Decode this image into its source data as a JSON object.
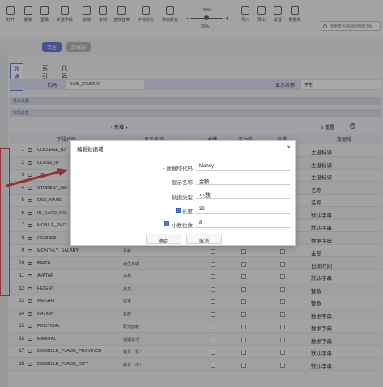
{
  "toolbar": {
    "buttons": [
      "打开",
      "撤销",
      "重做",
      "新建字段",
      "删除",
      "复制",
      "查找替换",
      "字体颜色",
      "填充颜色",
      "导入",
      "导出",
      "设置",
      "数据库"
    ],
    "zoom": "100%",
    "zoom_label": "50%",
    "search_placeholder": "搜索表名/视图/存储过程"
  },
  "doc_tabs": [
    "学生",
    "数据表"
  ],
  "sub_tabs": [
    "数据表",
    "索引",
    "代码"
  ],
  "code_row": {
    "code_label": "代码",
    "code_value": "SIMS_STUDENT",
    "display_label": "显示名称",
    "display_value": "学生"
  },
  "sections": [
    "基本设置",
    "字段信息"
  ],
  "table_toolbar": {
    "new_label": "+ 新增 ▾",
    "reset_label": "≡ 重置",
    "info": "?"
  },
  "columns": [
    "字段代码",
    "显示名称",
    "主键",
    "不为空",
    "自增",
    "数据域"
  ],
  "rows": [
    {
      "no": "1",
      "code": "COLLEGE_ID",
      "display": "",
      "domain": "主键标识"
    },
    {
      "no": "2",
      "code": "CLASS_ID",
      "display": "",
      "domain": "主键标识"
    },
    {
      "no": "3",
      "code": "_ID",
      "display": "",
      "domain": "主键标识"
    },
    {
      "no": "4",
      "code": "STUDENT_NA",
      "display": "",
      "domain": "名称"
    },
    {
      "no": "5",
      "code": "ENG_NAME",
      "display": "",
      "domain": "名称"
    },
    {
      "no": "6",
      "code": "ID_CARD_NO",
      "display": "",
      "domain": "默认字串"
    },
    {
      "no": "7",
      "code": "MOBILE_PHO",
      "display": "",
      "domain": "默认字串"
    },
    {
      "no": "8",
      "code": "GENDER",
      "display": "",
      "domain": "数据字典"
    },
    {
      "no": "9",
      "code": "MONTHLY_SALARY",
      "display": "月薪",
      "domain": "金额"
    },
    {
      "no": "10",
      "code": "BIRTH",
      "display": "出生日期",
      "domain": "日期时间"
    },
    {
      "no": "11",
      "code": "AVATAR",
      "display": "头像",
      "domain": "默认字串"
    },
    {
      "no": "12",
      "code": "HEIGHT",
      "display": "身高",
      "domain": "整数"
    },
    {
      "no": "13",
      "code": "WEIGHT",
      "display": "体重",
      "domain": "整数"
    },
    {
      "no": "14",
      "code": "NATION",
      "display": "名族",
      "domain": "数据字典"
    },
    {
      "no": "15",
      "code": "POLITICAL",
      "display": "政治面貌",
      "domain": "数据字典"
    },
    {
      "no": "16",
      "code": "MARITAL",
      "display": "婚姻状况",
      "domain": "数据字典"
    },
    {
      "no": "17",
      "code": "DOMICILE_PLACE_PROVINCE",
      "display": "籍贯（省）",
      "domain": "默认字串"
    },
    {
      "no": "18",
      "code": "DOMICILE_PLACE_CITY",
      "display": "籍贯（市）",
      "domain": "默认字串"
    }
  ],
  "modal": {
    "title": "编辑数据域",
    "close": "×",
    "fields": [
      {
        "label": "• 数据域代码",
        "value": "Money"
      },
      {
        "label": "显示名称",
        "value": "金额"
      },
      {
        "label": "数据类型",
        "value": "小数"
      },
      {
        "label": "长度",
        "value": "32"
      },
      {
        "label": "小数位数",
        "value": "8"
      }
    ],
    "ok_label": "确定",
    "cancel_label": "取消"
  },
  "colors": {
    "accent": "#6a7fd6",
    "highlight": "#e24b4b",
    "checkbox": "#4a7bd6"
  }
}
